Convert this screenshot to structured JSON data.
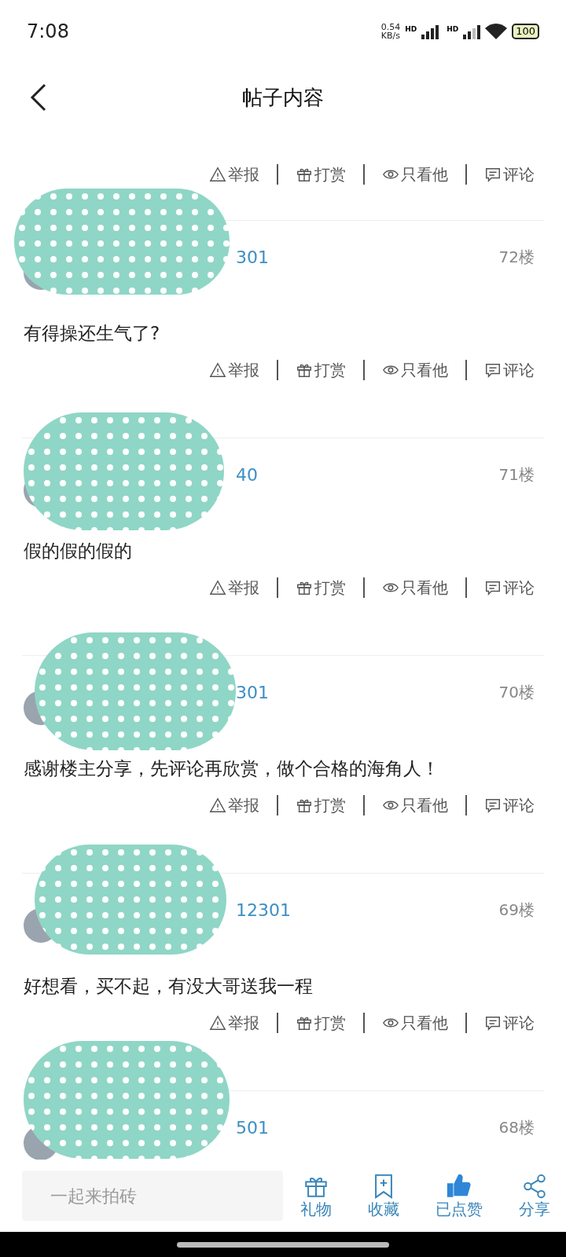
{
  "status_bar": {
    "time": "7:08",
    "speed": "0.54",
    "speed_unit": "KB/s",
    "network_1": "HD",
    "network_2": "HD",
    "battery": "100"
  },
  "header": {
    "title": "帖子内容"
  },
  "top_actions": [
    "举报",
    "打赏",
    "只看他",
    "评论"
  ],
  "posts": [
    {
      "username": "301",
      "floor": "72楼",
      "content": "有得操还生气了?",
      "actions": [
        "举报",
        "打赏",
        "只看他",
        "评论"
      ]
    },
    {
      "username": "40",
      "floor": "71楼",
      "content": "假的假的假的",
      "actions": [
        "举报",
        "打赏",
        "只看他",
        "评论"
      ]
    },
    {
      "username": "301",
      "floor": "70楼",
      "content": "感谢楼主分享，先评论再欣赏，做个合格的海角人！",
      "actions": [
        "举报",
        "打赏",
        "只看他",
        "评论"
      ]
    },
    {
      "username": "12301",
      "floor": "69楼",
      "content": "好想看，买不起，有没大哥送我一程",
      "actions": [
        "举报",
        "打赏",
        "只看他",
        "评论"
      ]
    },
    {
      "username": "501",
      "floor": "68楼"
    }
  ],
  "bottom_bar": {
    "comment_placeholder": "一起来拍砖",
    "buttons": [
      {
        "kind": "gift",
        "label": "礼物",
        "active": false
      },
      {
        "kind": "bookmark",
        "label": "收藏",
        "active": false
      },
      {
        "kind": "like",
        "label": "已点赞",
        "active": true
      },
      {
        "kind": "share",
        "label": "分享",
        "active": false
      }
    ]
  }
}
